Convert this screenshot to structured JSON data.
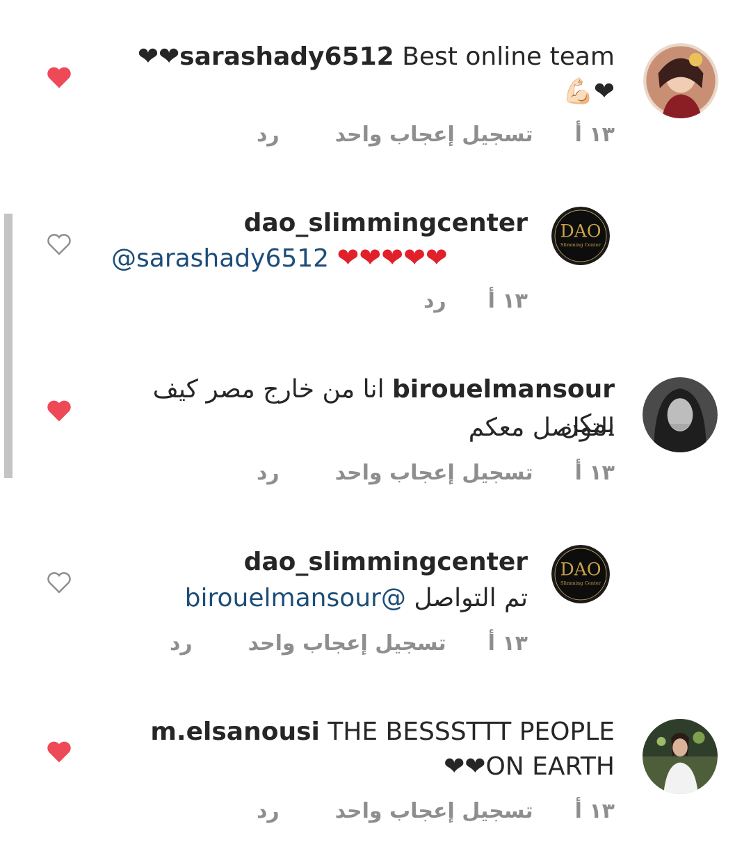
{
  "comments": [
    {
      "username": "sarashady6512",
      "text": "Best online team❤❤",
      "line2": "❤💪🏻",
      "time": "١٣ أ",
      "likes_label": "تسجيل إعجاب واحد",
      "reply_label": "رد",
      "liked": true
    },
    {
      "username": "dao_slimmingcenter",
      "mention": "@sarashady6512",
      "text": "❤❤❤❤❤",
      "time": "١٣ أ",
      "reply_label": "رد",
      "liked": false
    },
    {
      "username": "birouelmansour",
      "text": "انا من خارج مصر كيف يمكن",
      "line2": "التواصل معكم",
      "time": "١٣ أ",
      "likes_label": "تسجيل إعجاب واحد",
      "reply_label": "رد",
      "liked": true
    },
    {
      "username": "dao_slimmingcenter",
      "text": "تم التواصل",
      "mention": "@birouelmansour",
      "time": "١٣ أ",
      "likes_label": "تسجيل إعجاب واحد",
      "reply_label": "رد",
      "liked": false
    },
    {
      "username": "m.elsanousi",
      "text": "THE BESSSTTT PEOPLE",
      "line2": "ON EARTH❤❤",
      "time": "١٣ أ",
      "likes_label": "تسجيل إعجاب واحد",
      "reply_label": "رد",
      "liked": true
    }
  ],
  "colors": {
    "liked_heart": "#ed4956",
    "unliked_heart": "#8e8e8e",
    "mention": "#1c4d78",
    "meta": "#8e8e8e"
  },
  "icons": [
    "heart-filled-icon",
    "heart-outline-icon"
  ]
}
